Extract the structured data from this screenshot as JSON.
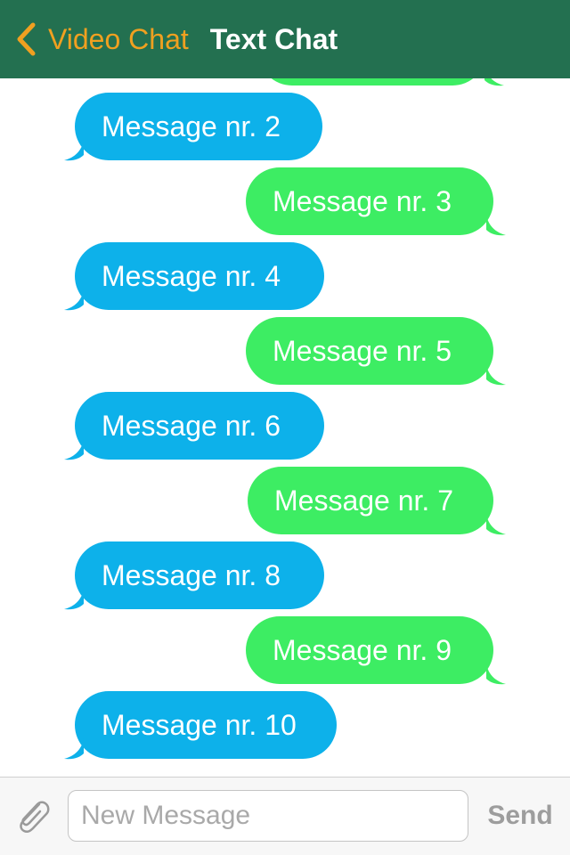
{
  "header": {
    "back_label": "Video Chat",
    "title": "Text Chat",
    "back_icon": "chevron-left-icon"
  },
  "messages": [
    {
      "text": "",
      "direction": "sent"
    },
    {
      "text": "Message nr. 2",
      "direction": "received"
    },
    {
      "text": "Message nr. 3",
      "direction": "sent"
    },
    {
      "text": "Message nr. 4",
      "direction": "received"
    },
    {
      "text": "Message nr. 5",
      "direction": "sent"
    },
    {
      "text": "Message nr. 6",
      "direction": "received"
    },
    {
      "text": "Message nr. 7",
      "direction": "sent"
    },
    {
      "text": "Message nr. 8",
      "direction": "received"
    },
    {
      "text": "Message nr. 9",
      "direction": "sent"
    },
    {
      "text": "Message nr. 10",
      "direction": "received"
    }
  ],
  "composer": {
    "attach_icon": "paperclip-icon",
    "input_value": "",
    "input_placeholder": "New Message",
    "send_label": "Send"
  },
  "colors": {
    "header_background": "#237050",
    "back_label": "#f0a020",
    "received_bubble": "#0db1ea",
    "sent_bubble": "#3ded63",
    "send_button": "#9d9d9d"
  }
}
